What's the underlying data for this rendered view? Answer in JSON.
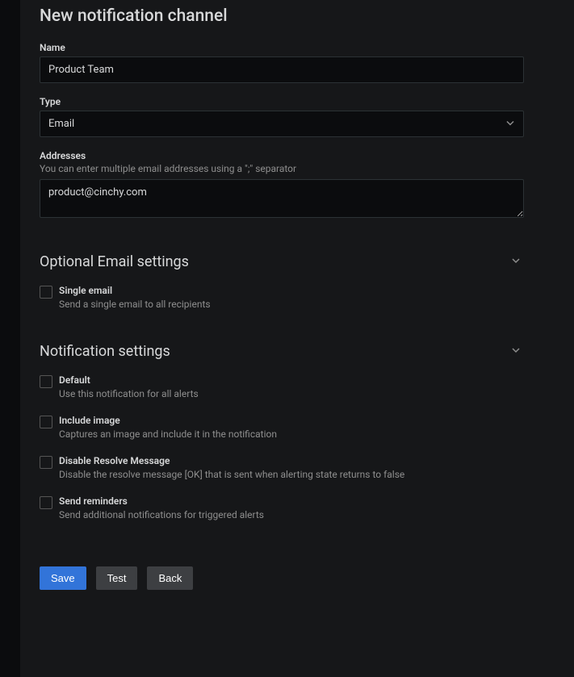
{
  "page": {
    "title": "New notification channel"
  },
  "fields": {
    "name": {
      "label": "Name",
      "value": "Product Team"
    },
    "type": {
      "label": "Type",
      "value": "Email"
    },
    "addresses": {
      "label": "Addresses",
      "help": "You can enter multiple email addresses using a \";\" separator",
      "value": "product@cinchy.com"
    }
  },
  "sections": {
    "optionalEmail": {
      "title": "Optional Email settings",
      "options": {
        "singleEmail": {
          "label": "Single email",
          "desc": "Send a single email to all recipients"
        }
      }
    },
    "notification": {
      "title": "Notification settings",
      "options": {
        "default": {
          "label": "Default",
          "desc": "Use this notification for all alerts"
        },
        "includeImage": {
          "label": "Include image",
          "desc": "Captures an image and include it in the notification"
        },
        "disableResolve": {
          "label": "Disable Resolve Message",
          "desc": "Disable the resolve message [OK] that is sent when alerting state returns to false"
        },
        "sendReminders": {
          "label": "Send reminders",
          "desc": "Send additional notifications for triggered alerts"
        }
      }
    }
  },
  "buttons": {
    "save": "Save",
    "test": "Test",
    "back": "Back"
  }
}
